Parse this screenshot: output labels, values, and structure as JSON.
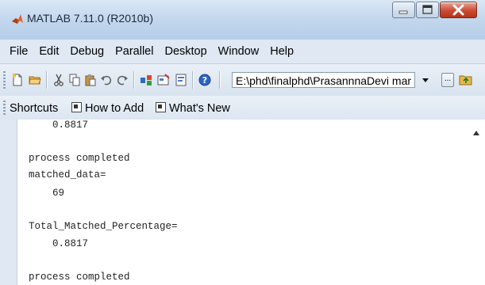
{
  "window": {
    "title": "MATLAB  7.11.0 (R2010b)",
    "controls": {
      "minimize": "minimize",
      "maximize": "maximize",
      "close": "close"
    }
  },
  "menu": [
    "File",
    "Edit",
    "Debug",
    "Parallel",
    "Desktop",
    "Window",
    "Help"
  ],
  "toolbar": {
    "icons": [
      "new-file-icon",
      "open-folder-icon",
      "cut-icon",
      "copy-icon",
      "paste-icon",
      "undo-icon",
      "redo-icon",
      "simulink-icon",
      "guide-icon",
      "profiler-icon",
      "help-icon"
    ],
    "current_folder": "E:\\phd\\finalphd\\PrasannnaDevi mar",
    "browse_label": "..."
  },
  "shortcuts": {
    "label": "Shortcuts",
    "items": [
      "How to Add",
      "What's New"
    ]
  },
  "command_window": {
    "lines": [
      "    0.8817",
      "",
      "process completed",
      "matched_data=",
      "    69",
      "",
      "Total_Matched_Percentage=",
      "    0.8817",
      "",
      "process completed"
    ]
  },
  "colors": {
    "titlebar": "#c4d8ee",
    "menubar": "#dfe8f3",
    "close_button": "#cc4b33"
  }
}
